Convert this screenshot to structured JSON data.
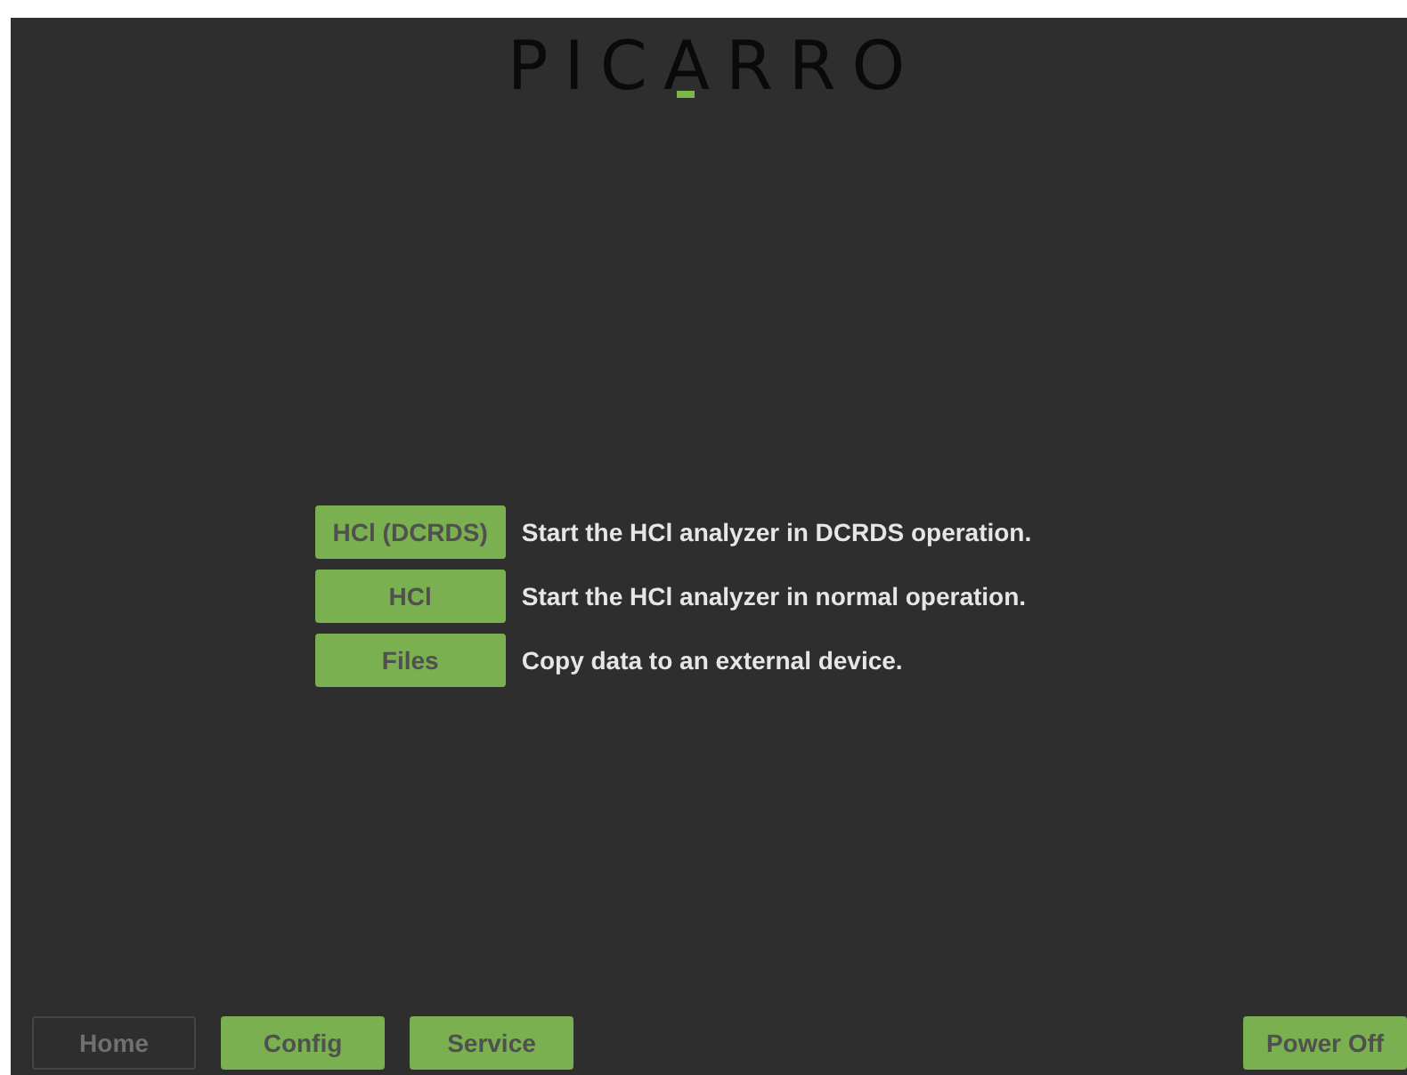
{
  "logo": {
    "text": "PICARRO"
  },
  "modes": [
    {
      "button": "HCl (DCRDS)",
      "description": "Start the HCl analyzer in DCRDS operation."
    },
    {
      "button": "HCl",
      "description": "Start the HCl analyzer in normal operation."
    },
    {
      "button": "Files",
      "description": "Copy data to an external device."
    }
  ],
  "nav_buttons": [
    {
      "label": "Home",
      "disabled": true
    },
    {
      "label": "Config",
      "disabled": false
    },
    {
      "label": "Service",
      "disabled": false
    }
  ],
  "power_button": {
    "label": "Power Off",
    "disabled": false
  }
}
